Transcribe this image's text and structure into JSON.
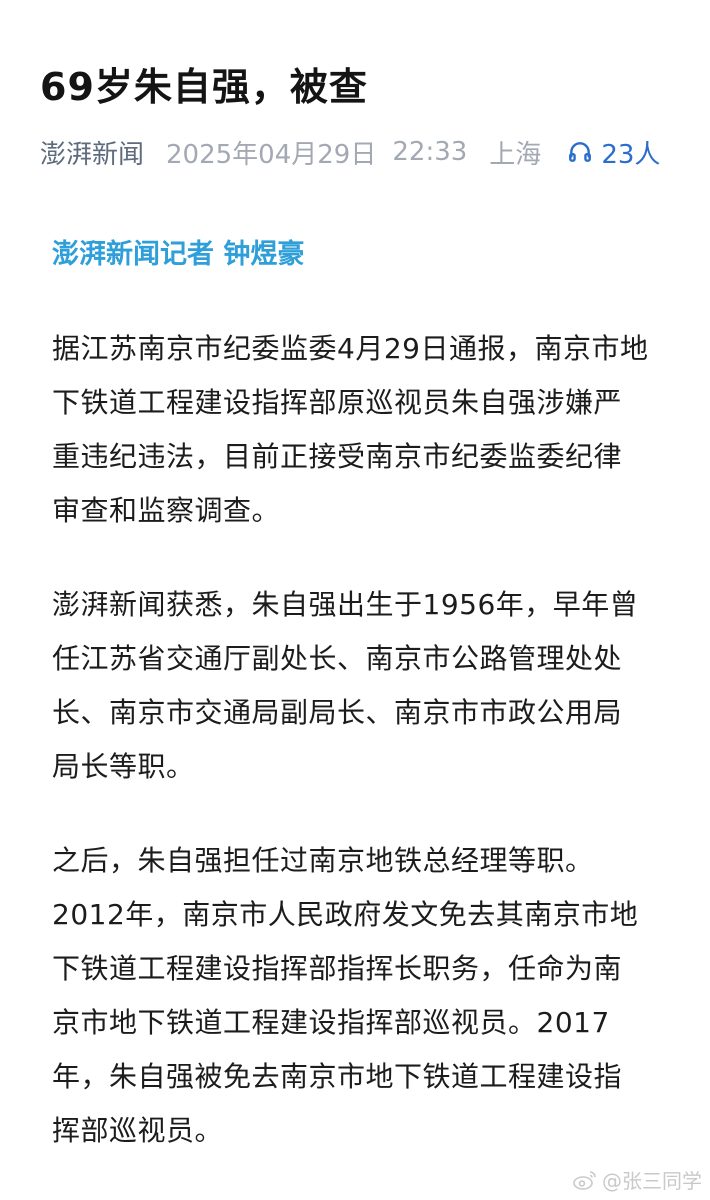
{
  "article": {
    "title": "69岁朱自强，被查",
    "meta": {
      "source": "澎湃新闻",
      "date": "2025年04月29日",
      "time": "22:33",
      "location": "上海",
      "listeners": "23人",
      "listen_icon": "headphones-icon"
    },
    "byline": "澎湃新闻记者 钟煜豪",
    "paragraphs": [
      {
        "lines": [
          "据江苏南京市纪委监委4月29日通报，南京市地",
          "下铁道工程建设指挥部原巡视员朱自强涉嫌严",
          "重违纪违法，目前正接受南京市纪委监委纪律",
          "审查和监察调查。"
        ]
      },
      {
        "lines": [
          "澎湃新闻获悉，朱自强出生于1956年，早年曾",
          "任江苏省交通厅副处长、南京市公路管理处处",
          "长、南京市交通局副局长、南京市市政公用局",
          "局长等职。"
        ]
      },
      {
        "lines": [
          "之后，朱自强担任过南京地铁总经理等职。",
          "2012年，南京市人民政府发文免去其南京市地",
          "下铁道工程建设指挥部指挥长职务，任命为南",
          "京市地下铁道工程建设指挥部巡视员。2017",
          "年，朱自强被免去南京市地下铁道工程建设指",
          "挥部巡视员。"
        ]
      }
    ]
  },
  "watermark": {
    "text": "@张三同学",
    "icon": "weibo-logo-icon"
  },
  "colors": {
    "title": "#141414",
    "source": "#5d6b7c",
    "meta": "#a3a9b3",
    "accent_blue": "#2b6dcc",
    "byline": "#2e9fd8",
    "body_text": "#1c1c1c",
    "watermark": "#c9c9c9"
  }
}
